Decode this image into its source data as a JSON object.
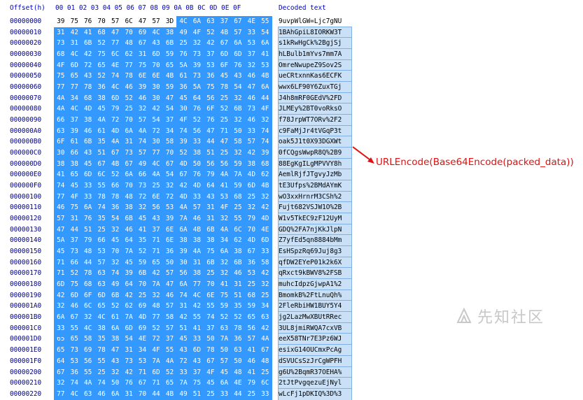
{
  "header": {
    "offset_label": "Offset(h)",
    "columns_label": "00 01 02 03 04 05 06 07 08 09 0A 0B 0C 0D 0E 0F",
    "decoded_label": "Decoded text"
  },
  "selection_start_index": 8,
  "rows": [
    {
      "offset": "00000000",
      "hex": [
        "39",
        "75",
        "76",
        "70",
        "57",
        "6C",
        "47",
        "57",
        "3D",
        "4C",
        "6A",
        "63",
        "37",
        "67",
        "4E",
        "55"
      ],
      "text": "9uvpWlGW=Ljc7gNU"
    },
    {
      "offset": "00000010",
      "hex": [
        "31",
        "42",
        "41",
        "68",
        "47",
        "70",
        "69",
        "4C",
        "38",
        "49",
        "4F",
        "52",
        "4B",
        "57",
        "33",
        "54"
      ],
      "text": "1BAhGpiL8IORKW3T"
    },
    {
      "offset": "00000020",
      "hex": [
        "73",
        "31",
        "6B",
        "52",
        "77",
        "48",
        "67",
        "43",
        "6B",
        "25",
        "32",
        "42",
        "67",
        "6A",
        "53",
        "6A"
      ],
      "text": "s1kRwHgCk%2BgjSj"
    },
    {
      "offset": "00000030",
      "hex": [
        "68",
        "4C",
        "42",
        "75",
        "6C",
        "62",
        "31",
        "6D",
        "59",
        "76",
        "73",
        "37",
        "6D",
        "6D",
        "37",
        "41"
      ],
      "text": "hLBulb1mYvs7mm7A"
    },
    {
      "offset": "00000040",
      "hex": [
        "4F",
        "6D",
        "72",
        "65",
        "4E",
        "77",
        "75",
        "70",
        "65",
        "5A",
        "39",
        "53",
        "6F",
        "76",
        "32",
        "53"
      ],
      "text": "OmreNwupeZ9Sov2S"
    },
    {
      "offset": "00000050",
      "hex": [
        "75",
        "65",
        "43",
        "52",
        "74",
        "78",
        "6E",
        "6E",
        "4B",
        "61",
        "73",
        "36",
        "45",
        "43",
        "46",
        "4B"
      ],
      "text": "ueCRtxnnKas6ECFK"
    },
    {
      "offset": "00000060",
      "hex": [
        "77",
        "77",
        "78",
        "36",
        "4C",
        "46",
        "39",
        "30",
        "59",
        "36",
        "5A",
        "75",
        "78",
        "54",
        "47",
        "6A"
      ],
      "text": "wwx6LF90Y6ZuxTGj"
    },
    {
      "offset": "00000070",
      "hex": [
        "4A",
        "34",
        "68",
        "38",
        "6D",
        "52",
        "46",
        "30",
        "47",
        "45",
        "64",
        "56",
        "25",
        "32",
        "46",
        "44"
      ],
      "text": "J4h8mRF0GEdV%2FD"
    },
    {
      "offset": "00000080",
      "hex": [
        "4A",
        "4C",
        "4D",
        "45",
        "79",
        "25",
        "32",
        "42",
        "54",
        "30",
        "76",
        "6F",
        "52",
        "6B",
        "73",
        "4F"
      ],
      "text": "JLMEy%2BT0voRksO"
    },
    {
      "offset": "00000090",
      "hex": [
        "66",
        "37",
        "38",
        "4A",
        "72",
        "70",
        "57",
        "54",
        "37",
        "4F",
        "52",
        "76",
        "25",
        "32",
        "46",
        "32"
      ],
      "text": "f78JrpWT7ORv%2F2"
    },
    {
      "offset": "000000A0",
      "hex": [
        "63",
        "39",
        "46",
        "61",
        "4D",
        "6A",
        "4A",
        "72",
        "34",
        "74",
        "56",
        "47",
        "71",
        "50",
        "33",
        "74"
      ],
      "text": "c9FaMjJr4tVGqP3t"
    },
    {
      "offset": "000000B0",
      "hex": [
        "6F",
        "61",
        "6B",
        "35",
        "4A",
        "31",
        "74",
        "30",
        "58",
        "39",
        "33",
        "44",
        "47",
        "58",
        "57",
        "74"
      ],
      "text": "oak5J1t0X93DGXWt"
    },
    {
      "offset": "000000C0",
      "hex": [
        "30",
        "66",
        "43",
        "51",
        "67",
        "73",
        "57",
        "77",
        "70",
        "52",
        "38",
        "51",
        "25",
        "32",
        "42",
        "39"
      ],
      "text": "0fCQgsWwpR8Q%2B9"
    },
    {
      "offset": "000000D0",
      "hex": [
        "38",
        "38",
        "45",
        "67",
        "4B",
        "67",
        "49",
        "4C",
        "67",
        "4D",
        "50",
        "56",
        "56",
        "59",
        "38",
        "68"
      ],
      "text": "88EgKgILgMPVVY8h"
    },
    {
      "offset": "000000E0",
      "hex": [
        "41",
        "65",
        "6D",
        "6C",
        "52",
        "6A",
        "66",
        "4A",
        "54",
        "67",
        "76",
        "79",
        "4A",
        "7A",
        "4D",
        "62"
      ],
      "text": "AemlRjfJTgvyJzMb"
    },
    {
      "offset": "000000F0",
      "hex": [
        "74",
        "45",
        "33",
        "55",
        "66",
        "70",
        "73",
        "25",
        "32",
        "42",
        "4D",
        "64",
        "41",
        "59",
        "6D",
        "4B"
      ],
      "text": "tE3Ufps%2BMdAYmK"
    },
    {
      "offset": "00000100",
      "hex": [
        "77",
        "4F",
        "33",
        "78",
        "78",
        "48",
        "72",
        "6E",
        "72",
        "4D",
        "33",
        "43",
        "53",
        "68",
        "25",
        "32"
      ],
      "text": "wO3xxHrnrM3CSh%2"
    },
    {
      "offset": "00000110",
      "hex": [
        "46",
        "75",
        "6A",
        "74",
        "36",
        "38",
        "32",
        "56",
        "53",
        "4A",
        "57",
        "31",
        "4F",
        "25",
        "32",
        "42"
      ],
      "text": "Fujt682VSJW1O%2B"
    },
    {
      "offset": "00000120",
      "hex": [
        "57",
        "31",
        "76",
        "35",
        "54",
        "6B",
        "45",
        "43",
        "39",
        "7A",
        "46",
        "31",
        "32",
        "55",
        "79",
        "4D"
      ],
      "text": "W1v5TkEC9zF12UyM"
    },
    {
      "offset": "00000130",
      "hex": [
        "47",
        "44",
        "51",
        "25",
        "32",
        "46",
        "41",
        "37",
        "6E",
        "6A",
        "4B",
        "6B",
        "4A",
        "6C",
        "70",
        "4E"
      ],
      "text": "GDQ%2FA7njKkJlpN"
    },
    {
      "offset": "00000140",
      "hex": [
        "5A",
        "37",
        "79",
        "66",
        "45",
        "64",
        "35",
        "71",
        "6E",
        "38",
        "38",
        "38",
        "34",
        "62",
        "4D",
        "6D"
      ],
      "text": "Z7yfEd5qn8884bMm"
    },
    {
      "offset": "00000150",
      "hex": [
        "45",
        "73",
        "48",
        "53",
        "70",
        "7A",
        "52",
        "71",
        "36",
        "39",
        "4A",
        "75",
        "6A",
        "38",
        "67",
        "33"
      ],
      "text": "EsHSpzRq69Juj8g3"
    },
    {
      "offset": "00000160",
      "hex": [
        "71",
        "66",
        "44",
        "57",
        "32",
        "45",
        "59",
        "65",
        "50",
        "30",
        "31",
        "6B",
        "32",
        "6B",
        "36",
        "58"
      ],
      "text": "qfDW2EYeP01k2k6X"
    },
    {
      "offset": "00000170",
      "hex": [
        "71",
        "52",
        "78",
        "63",
        "74",
        "39",
        "6B",
        "42",
        "57",
        "56",
        "38",
        "25",
        "32",
        "46",
        "53",
        "42"
      ],
      "text": "qRxct9kBWV8%2FSB"
    },
    {
      "offset": "00000180",
      "hex": [
        "6D",
        "75",
        "68",
        "63",
        "49",
        "64",
        "70",
        "7A",
        "47",
        "6A",
        "77",
        "70",
        "41",
        "31",
        "25",
        "32"
      ],
      "text": "muhcIdpzGjwpA1%2"
    },
    {
      "offset": "00000190",
      "hex": [
        "42",
        "6D",
        "6F",
        "6D",
        "6B",
        "42",
        "25",
        "32",
        "46",
        "74",
        "4C",
        "6E",
        "75",
        "51",
        "68",
        "25"
      ],
      "text": "BmomkB%2FtLnuQh%"
    },
    {
      "offset": "000001A0",
      "hex": [
        "32",
        "46",
        "6C",
        "65",
        "52",
        "62",
        "69",
        "48",
        "57",
        "31",
        "42",
        "55",
        "59",
        "35",
        "59",
        "34"
      ],
      "text": "2FleRbiHW1BUY5Y4"
    },
    {
      "offset": "000001B0",
      "hex": [
        "6A",
        "67",
        "32",
        "4C",
        "61",
        "7A",
        "4D",
        "77",
        "58",
        "42",
        "55",
        "74",
        "52",
        "52",
        "65",
        "63"
      ],
      "text": "jg2LazMwXBUtRRec"
    },
    {
      "offset": "000001C0",
      "hex": [
        "33",
        "55",
        "4C",
        "38",
        "6A",
        "6D",
        "69",
        "52",
        "57",
        "51",
        "41",
        "37",
        "63",
        "78",
        "56",
        "42"
      ],
      "text": "3UL8jmiRWQA7cxVB"
    },
    {
      "offset": "000001D0",
      "hex": [
        "65",
        "65",
        "58",
        "35",
        "38",
        "54",
        "4E",
        "72",
        "37",
        "45",
        "33",
        "50",
        "7A",
        "36",
        "57",
        "4A"
      ],
      "text": "eeX58TNr7E3Pz6WJ"
    },
    {
      "offset": "000001E0",
      "hex": [
        "65",
        "73",
        "69",
        "78",
        "47",
        "31",
        "34",
        "4F",
        "55",
        "43",
        "6D",
        "78",
        "50",
        "63",
        "41",
        "67"
      ],
      "text": "esixG14OUCmxPcAg"
    },
    {
      "offset": "000001F0",
      "hex": [
        "64",
        "53",
        "56",
        "55",
        "43",
        "73",
        "53",
        "7A",
        "4A",
        "72",
        "43",
        "67",
        "57",
        "50",
        "46",
        "48"
      ],
      "text": "dSVUCsSzJrCgWPFH"
    },
    {
      "offset": "00000200",
      "hex": [
        "67",
        "36",
        "55",
        "25",
        "32",
        "42",
        "71",
        "6D",
        "52",
        "33",
        "37",
        "4F",
        "45",
        "48",
        "41",
        "25"
      ],
      "text": "g6U%2BqmR37OEHA%"
    },
    {
      "offset": "00000210",
      "hex": [
        "32",
        "74",
        "4A",
        "74",
        "50",
        "76",
        "67",
        "71",
        "65",
        "7A",
        "75",
        "45",
        "6A",
        "4E",
        "79",
        "6C"
      ],
      "text": "2tJtPvgqezuEjNyl"
    },
    {
      "offset": "00000220",
      "hex": [
        "77",
        "4C",
        "63",
        "46",
        "6A",
        "31",
        "70",
        "44",
        "4B",
        "49",
        "51",
        "25",
        "33",
        "44",
        "25",
        "33"
      ],
      "text": "wLcFj1pDKIQ%3D%3"
    }
  ],
  "annotation": {
    "text": "URLEncode(Base64Encode(packed_data))",
    "color": "#e01010"
  },
  "watermark": {
    "text": "先知社区"
  }
}
